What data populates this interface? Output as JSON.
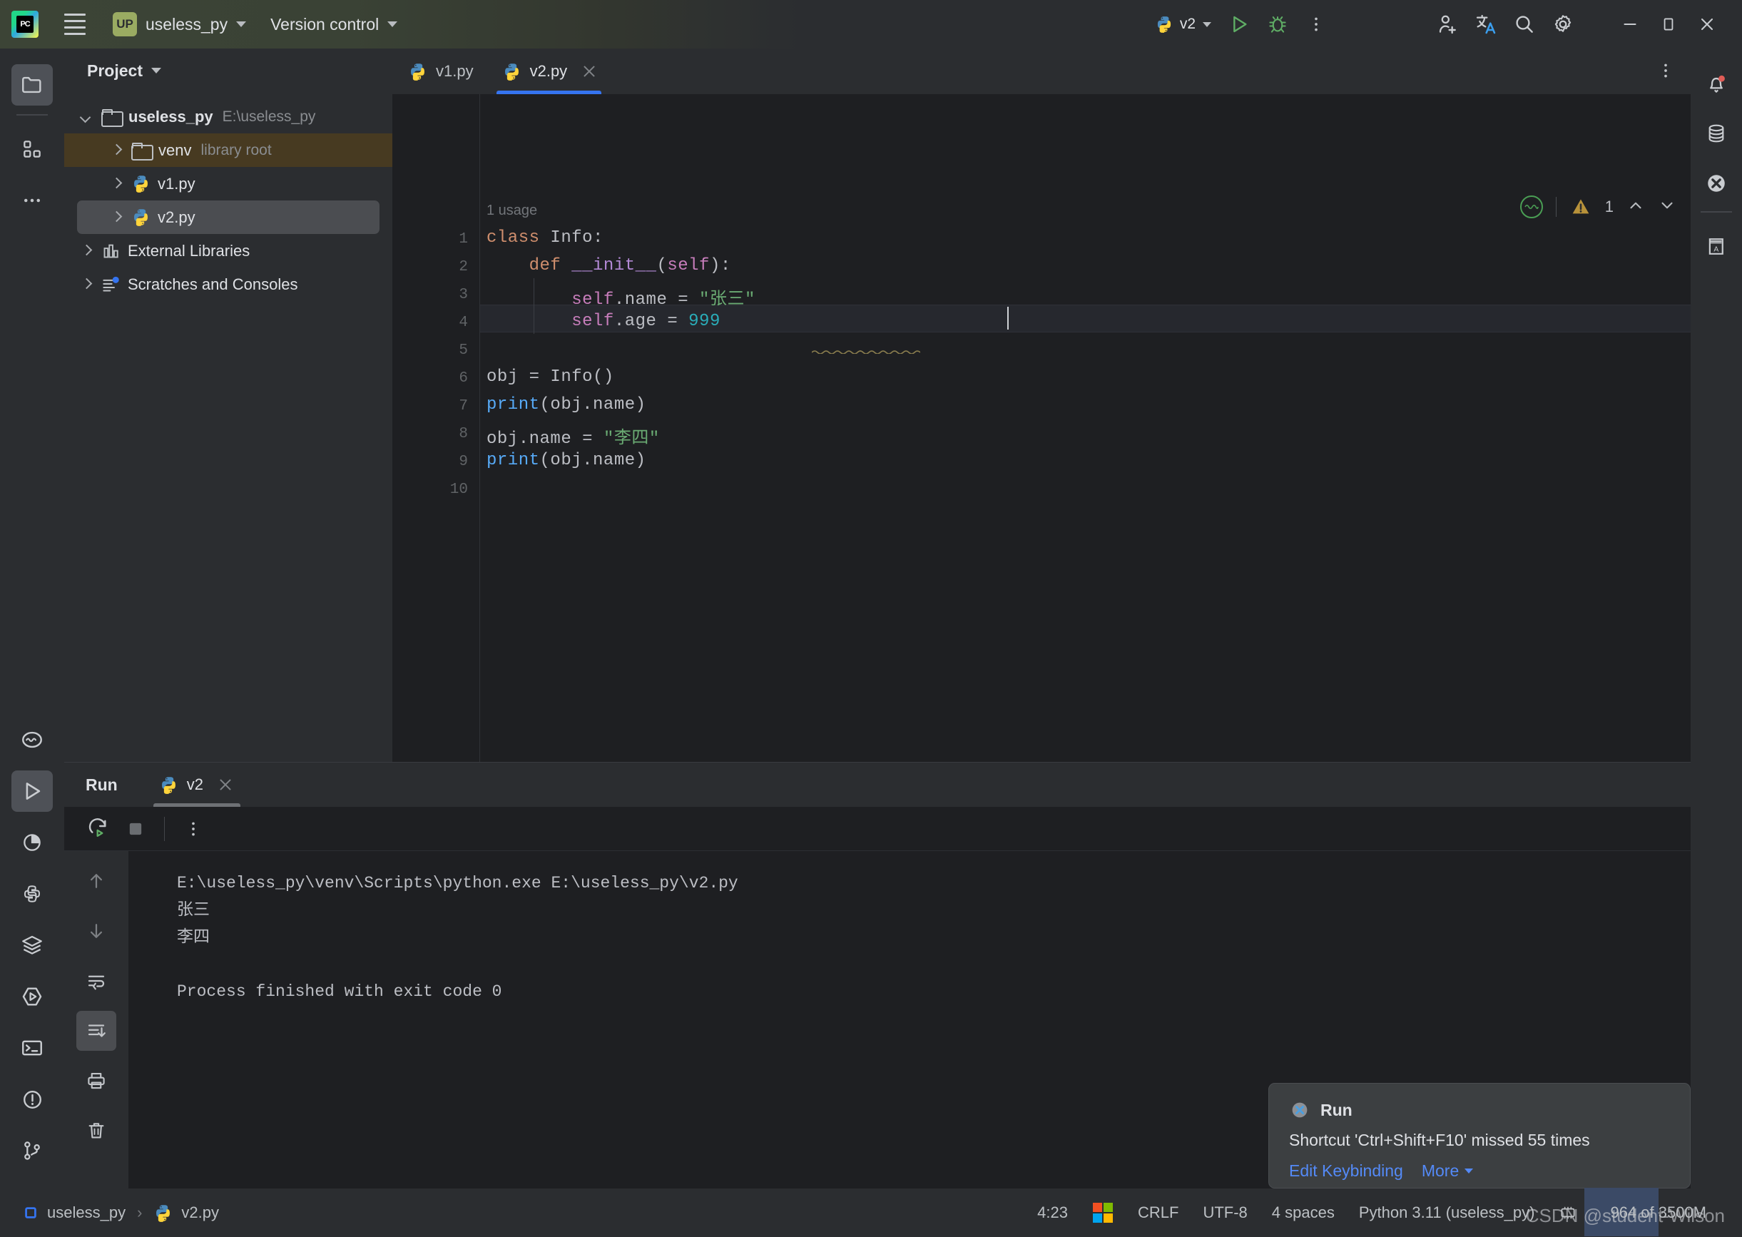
{
  "titlebar": {
    "logo_icon": "pycharm-logo-icon",
    "logo_text": "PC",
    "menu_icon": "hamburger-menu-icon",
    "project_badge": "UP",
    "project_name": "useless_py",
    "vcs_label": "Version control",
    "run_config": "v2",
    "run_icon": "run-triangle-icon",
    "debug_icon": "debug-bug-icon",
    "more_icon": "more-vertical-icon",
    "account_icon": "add-account-icon",
    "translate_icon": "translate-icon",
    "search_icon": "search-magnifier-icon",
    "settings_icon": "gear-settings-icon",
    "minimize_icon": "window-minimize-icon",
    "maximize_icon": "window-maximize-icon",
    "close_icon": "window-close-icon"
  },
  "left_stripe": {
    "top": [
      {
        "name": "project-tool-icon",
        "active": true
      },
      {
        "name": "structure-tool-icon",
        "active": false
      },
      {
        "name": "more-tools-icon",
        "active": false
      }
    ],
    "bottom": [
      {
        "name": "ai-assistant-icon",
        "active": false
      },
      {
        "name": "run-tool-icon",
        "active": true
      },
      {
        "name": "profiler-tool-icon",
        "active": false
      },
      {
        "name": "python-packages-icon",
        "active": false
      },
      {
        "name": "database-layers-icon",
        "active": false
      },
      {
        "name": "run-configurations-icon",
        "active": false
      },
      {
        "name": "terminal-tool-icon",
        "active": false
      },
      {
        "name": "problems-tool-icon",
        "active": false
      },
      {
        "name": "version-control-icon",
        "active": false
      }
    ]
  },
  "right_stripe": {
    "items": [
      {
        "name": "notifications-bell-icon",
        "badge": true
      },
      {
        "name": "database-tool-icon",
        "badge": false
      },
      {
        "name": "plugin-x-icon",
        "badge": false
      },
      {
        "name": "learn-book-icon",
        "badge": false
      }
    ]
  },
  "project_panel": {
    "title": "Project",
    "chevron_icon": "chevron-down-icon",
    "tree": [
      {
        "indent": 0,
        "arrow": "open",
        "icon": "folder-icon",
        "label": "useless_py",
        "bold": true,
        "sub": "E:\\useless_py",
        "state": "normal"
      },
      {
        "indent": 1,
        "arrow": "closed",
        "icon": "folder-icon",
        "label": "venv",
        "bold": false,
        "sub": "library root",
        "state": "highlight"
      },
      {
        "indent": 1,
        "arrow": "closed",
        "icon": "python-file-icon",
        "label": "v1.py",
        "bold": false,
        "sub": "",
        "state": "normal"
      },
      {
        "indent": 1,
        "arrow": "closed",
        "icon": "python-file-icon",
        "label": "v2.py",
        "bold": false,
        "sub": "",
        "state": "selected"
      },
      {
        "indent": 0,
        "arrow": "closed",
        "icon": "external-libraries-icon",
        "label": "External Libraries",
        "bold": false,
        "sub": "",
        "state": "normal"
      },
      {
        "indent": 0,
        "arrow": "closed",
        "icon": "scratches-icon",
        "label": "Scratches and Consoles",
        "bold": false,
        "sub": "",
        "state": "normal"
      }
    ]
  },
  "editor": {
    "tabs": [
      {
        "label": "v1.py",
        "icon": "python-file-icon",
        "active": false,
        "closable": false
      },
      {
        "label": "v2.py",
        "icon": "python-file-icon",
        "active": true,
        "closable": true
      }
    ],
    "tab_more_icon": "more-vertical-icon",
    "usage_hint": "1 usage",
    "line_numbers": [
      "1",
      "2",
      "3",
      "4",
      "5",
      "6",
      "7",
      "8",
      "9",
      "10"
    ],
    "code_lines": [
      {
        "n": 1,
        "tokens": [
          {
            "t": "class ",
            "c": "kw"
          },
          {
            "t": "Info",
            "c": "cls"
          },
          {
            "t": ":",
            "c": "plain"
          }
        ]
      },
      {
        "n": 2,
        "tokens": [
          {
            "t": "    ",
            "c": "plain"
          },
          {
            "t": "def ",
            "c": "kw"
          },
          {
            "t": "__init__",
            "c": "mag"
          },
          {
            "t": "(",
            "c": "plain"
          },
          {
            "t": "self",
            "c": "self"
          },
          {
            "t": "):",
            "c": "plain"
          }
        ]
      },
      {
        "n": 3,
        "tokens": [
          {
            "t": "        ",
            "c": "plain"
          },
          {
            "t": "self",
            "c": "self"
          },
          {
            "t": ".name = ",
            "c": "plain"
          },
          {
            "t": "\"张三\"",
            "c": "str"
          }
        ]
      },
      {
        "n": 4,
        "tokens": [
          {
            "t": "        ",
            "c": "plain"
          },
          {
            "t": "self",
            "c": "self"
          },
          {
            "t": ".age = ",
            "c": "plain"
          },
          {
            "t": "999",
            "c": "num"
          }
        ]
      },
      {
        "n": 5,
        "tokens": []
      },
      {
        "n": 6,
        "tokens": [
          {
            "t": "obj = ",
            "c": "plain"
          },
          {
            "t": "Info",
            "c": "cls"
          },
          {
            "t": "()",
            "c": "plain"
          }
        ]
      },
      {
        "n": 7,
        "tokens": [
          {
            "t": "print",
            "c": "pfn"
          },
          {
            "t": "(obj.name)",
            "c": "plain"
          }
        ]
      },
      {
        "n": 8,
        "tokens": [
          {
            "t": "obj.name = ",
            "c": "plain"
          },
          {
            "t": "\"李四\"",
            "c": "str"
          }
        ]
      },
      {
        "n": 9,
        "tokens": [
          {
            "t": "print",
            "c": "pfn"
          },
          {
            "t": "(obj.name)",
            "c": "plain"
          }
        ]
      },
      {
        "n": 10,
        "tokens": []
      }
    ],
    "inspection": {
      "ok_icon": "inspection-ok-icon",
      "warning_icon": "warning-triangle-icon",
      "warning_count": "1",
      "prev_icon": "chevron-up-icon",
      "next_icon": "chevron-down-icon"
    }
  },
  "run_panel": {
    "title": "Run",
    "tab_label": "v2",
    "tab_icon": "python-file-icon",
    "tab_close_icon": "close-icon",
    "toolbar": [
      {
        "name": "rerun-button",
        "icon": "rerun-icon"
      },
      {
        "name": "stop-button",
        "icon": "stop-square-icon"
      },
      {
        "name": "run-more-button",
        "icon": "more-vertical-icon"
      }
    ],
    "gutter": [
      {
        "name": "scroll-up-button",
        "icon": "arrow-up-icon",
        "active": false
      },
      {
        "name": "scroll-down-button",
        "icon": "arrow-down-icon",
        "active": false
      },
      {
        "name": "soft-wrap-button",
        "icon": "soft-wrap-icon",
        "active": false
      },
      {
        "name": "scroll-to-end-button",
        "icon": "scroll-to-end-icon",
        "active": true
      },
      {
        "name": "print-button",
        "icon": "printer-icon",
        "active": false
      },
      {
        "name": "clear-all-button",
        "icon": "trash-icon",
        "active": false
      }
    ],
    "console_lines": [
      "E:\\useless_py\\venv\\Scripts\\python.exe E:\\useless_py\\v2.py",
      "张三",
      "李四",
      "",
      "Process finished with exit code 0"
    ]
  },
  "notification": {
    "icon": "plugin-x-icon",
    "title": "Run",
    "message": "Shortcut 'Ctrl+Shift+F10' missed 55 times",
    "link_edit": "Edit Keybinding",
    "link_more": "More",
    "more_chevron_icon": "chevron-down-icon"
  },
  "statusbar": {
    "breadcrumb_root_icon": "module-icon",
    "breadcrumb_root": "useless_py",
    "breadcrumb_sep": "›",
    "breadcrumb_file_icon": "python-file-icon",
    "breadcrumb_file": "v2.py",
    "cursor_position": "4:23",
    "os_icon": "windows-flag-icon",
    "line_separator": "CRLF",
    "encoding": "UTF-8",
    "indent": "4 spaces",
    "interpreter": "Python 3.11 (useless_py)",
    "memory_icon": "memory-indicator-icon",
    "memory": "964 of 3500M",
    "watermark": "CSDN @student-Wilson"
  },
  "colors": {
    "accent_blue": "#3574f0",
    "link_blue": "#548af7",
    "titlebar_green": "#3c4436",
    "panel_bg": "#2b2d30",
    "editor_bg": "#1e1f22",
    "selected_row": "#4b4d51",
    "highlight_row": "#473a21",
    "warning_amber": "#b8923a",
    "string_green": "#6aab73",
    "number_cyan": "#2aacb8"
  }
}
